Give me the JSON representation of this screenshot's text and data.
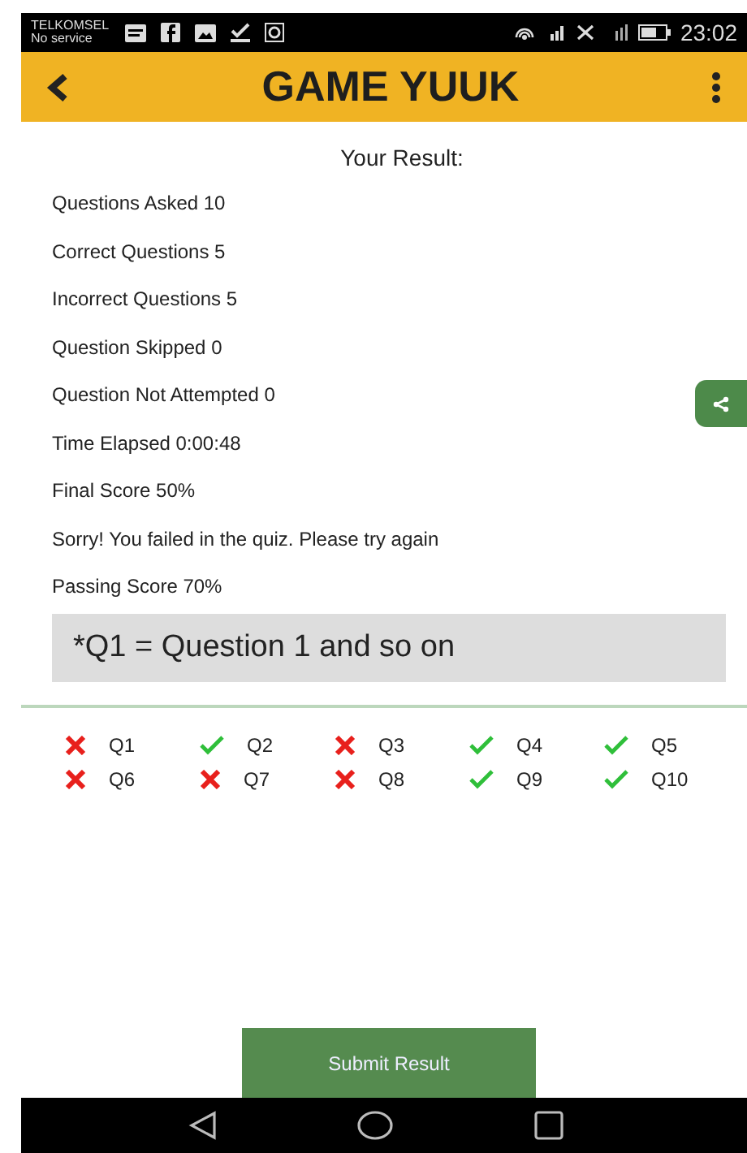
{
  "status_bar": {
    "carrier": "TELKOMSEL",
    "service": "No service",
    "time": "23:02"
  },
  "app_bar": {
    "title": "GAME YUUK"
  },
  "result": {
    "heading": "Your Result:",
    "lines": [
      "Questions Asked 10",
      "Correct Questions 5",
      "Incorrect Questions 5",
      "Question Skipped 0",
      "Question Not Attempted 0",
      "Time Elapsed 0:00:48",
      "Final Score 50%",
      "Sorry! You failed in the quiz. Please try again",
      "Passing Score 70%"
    ],
    "note": "*Q1 = Question 1 and so on"
  },
  "questions": [
    {
      "label": "Q1",
      "correct": false
    },
    {
      "label": "Q2",
      "correct": true
    },
    {
      "label": "Q3",
      "correct": false
    },
    {
      "label": "Q4",
      "correct": true
    },
    {
      "label": "Q5",
      "correct": true
    },
    {
      "label": "Q6",
      "correct": false
    },
    {
      "label": "Q7",
      "correct": false
    },
    {
      "label": "Q8",
      "correct": false
    },
    {
      "label": "Q9",
      "correct": true
    },
    {
      "label": "Q10",
      "correct": true
    }
  ],
  "submit_button": "Submit Result"
}
